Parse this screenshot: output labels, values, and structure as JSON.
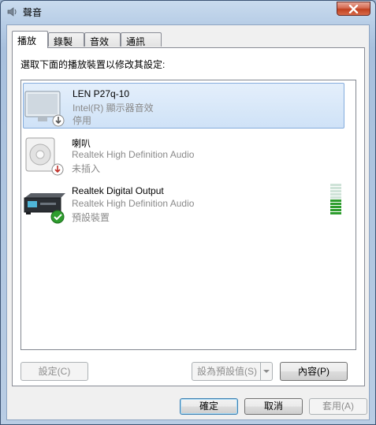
{
  "window": {
    "title": "聲音"
  },
  "tabs": [
    {
      "label": "播放",
      "active": true
    },
    {
      "label": "錄製",
      "active": false
    },
    {
      "label": "音效",
      "active": false
    },
    {
      "label": "通訊",
      "active": false
    }
  ],
  "instruction": "選取下面的播放裝置以修改其設定:",
  "devices": [
    {
      "name": "LEN P27q-10",
      "description": "Intel(R) 顯示器音效",
      "status": "停用",
      "icon": "monitor-speaker-icon",
      "badge": "down-arrow-badge",
      "selected": true
    },
    {
      "name": "喇叭",
      "description": "Realtek High Definition Audio",
      "status": "未插入",
      "icon": "speaker-icon",
      "badge": "down-arrow-badge",
      "selected": false
    },
    {
      "name": "Realtek Digital Output",
      "description": "Realtek High Definition Audio",
      "status": "預設裝置",
      "icon": "digital-output-icon",
      "badge": "default-check-badge",
      "selected": false,
      "level_meter": {
        "segments_total": 10,
        "segments_lit": 5
      }
    }
  ],
  "buttons": {
    "configure": "設定(C)",
    "set_default": "設為預設值(S)",
    "properties": "內容(P)",
    "ok": "確定",
    "cancel": "取消",
    "apply": "套用(A)"
  },
  "colors": {
    "selection": "#cfe2f7",
    "meter_lit": "#2e9d2e",
    "meter_unlit": "#cfe3d8",
    "close_button": "#c0401f"
  }
}
